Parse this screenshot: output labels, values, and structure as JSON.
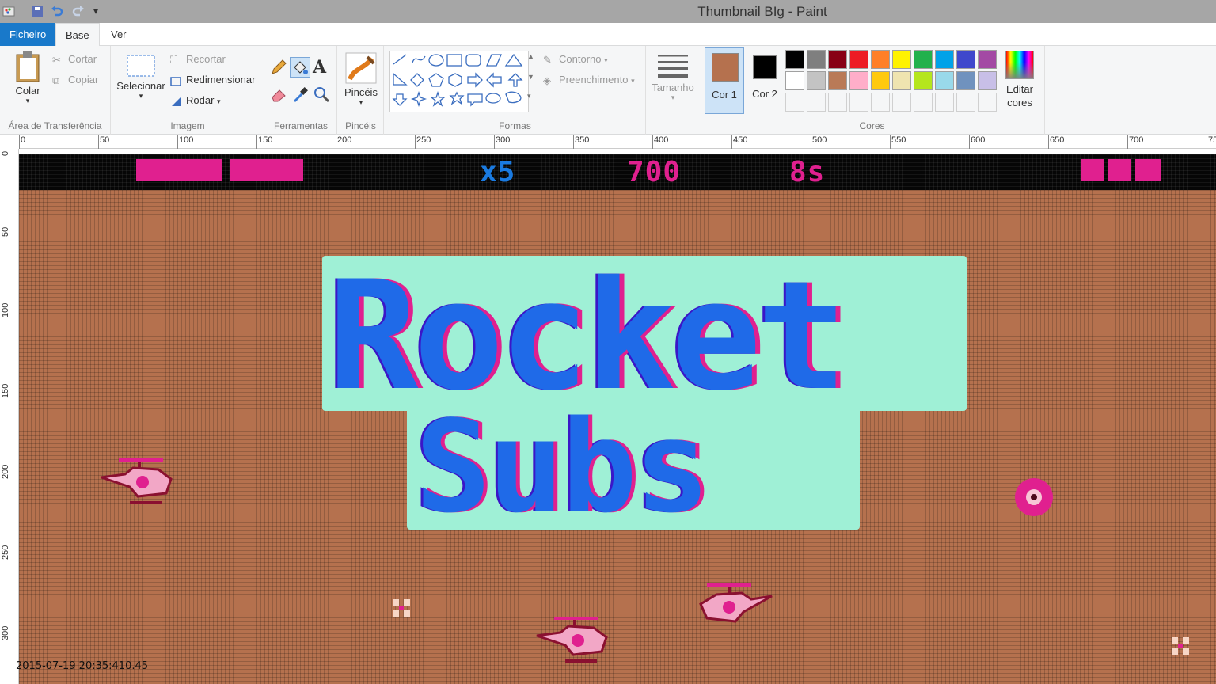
{
  "window": {
    "title": "Thumbnail BIg - Paint"
  },
  "menu": {
    "file": "Ficheiro",
    "home": "Base",
    "view": "Ver"
  },
  "clipboard": {
    "paste": "Colar",
    "cut": "Cortar",
    "copy": "Copiar",
    "label": "Área de Transferência"
  },
  "image": {
    "select": "Selecionar",
    "crop": "Recortar",
    "resize": "Redimensionar",
    "rotate": "Rodar",
    "label": "Imagem"
  },
  "tools": {
    "label": "Ferramentas"
  },
  "brushes": {
    "label": "Pincéis"
  },
  "shapes": {
    "outline": "Contorno",
    "fill": "Preenchimento",
    "label": "Formas"
  },
  "size": {
    "label": "Tamanho"
  },
  "colors": {
    "color1_label": "Cor 1",
    "color2_label": "Cor 2",
    "edit": "Editar cores",
    "label": "Cores",
    "color1": "#b5714e",
    "color2": "#000000",
    "palette_row1": [
      "#000000",
      "#7f7f7f",
      "#880015",
      "#ed1c24",
      "#ff7f27",
      "#fff200",
      "#22b14c",
      "#00a2e8",
      "#3f48cc",
      "#a349a4"
    ],
    "palette_row2": [
      "#ffffff",
      "#c3c3c3",
      "#b97a57",
      "#ffaec9",
      "#ffc90e",
      "#efe4b0",
      "#b5e61d",
      "#99d9ea",
      "#7092be",
      "#c8bfe7"
    ]
  },
  "ruler": {
    "top": [
      "0",
      "50",
      "100",
      "150",
      "200",
      "250",
      "300",
      "350",
      "400",
      "450",
      "500",
      "550",
      "600",
      "650",
      "700",
      "75"
    ],
    "left": [
      "0",
      "50",
      "100",
      "150",
      "200",
      "250",
      "300"
    ]
  },
  "game": {
    "lives": "x5",
    "score": "700",
    "time": "8s",
    "logo_line1": "Rocket",
    "logo_line2": "Subs",
    "colors": {
      "ground": "#b5714e",
      "hud_pink": "#e0208f",
      "hud_blue": "#1a7ae0",
      "logo_outline": "#9ff0d6",
      "logo_blue": "#1f6ae8",
      "logo_dark": "#3a16c8"
    }
  },
  "timestamp": "2015-07-19 20:35:410.45"
}
